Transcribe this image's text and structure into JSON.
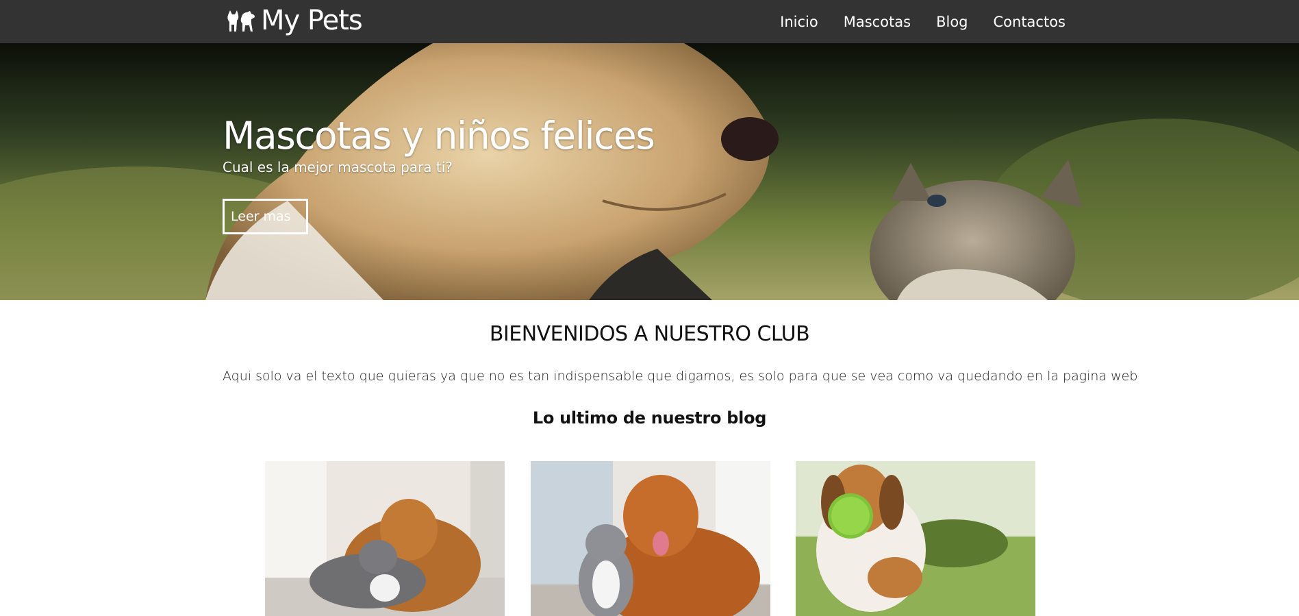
{
  "navbar": {
    "brand": "My Pets",
    "brand_icon": "pet-dog-cat-icon",
    "links": [
      "Inicio",
      "Mascotas",
      "Blog",
      "Contactos"
    ],
    "background": "#333333"
  },
  "hero": {
    "title": "Mascotas y niños felices",
    "subtitle": "Cual es la mejor mascota para ti?",
    "button": "Leer mas",
    "image": "dog-and-kitten-photo"
  },
  "welcome": {
    "title": "BIENVENIDOS A NUESTRO CLUB",
    "text": "Aqui solo va el texto que quieras ya que no es tan indispensable que digamos, es solo para que se vea como va quedando en la pagina web"
  },
  "blog": {
    "title": "Lo ultimo de nuestro blog",
    "cards": [
      {
        "image": "dog-and-cat-cuddling-photo"
      },
      {
        "image": "dog-and-kitten-sitting-photo"
      },
      {
        "image": "beagle-with-ball-photo"
      }
    ]
  }
}
